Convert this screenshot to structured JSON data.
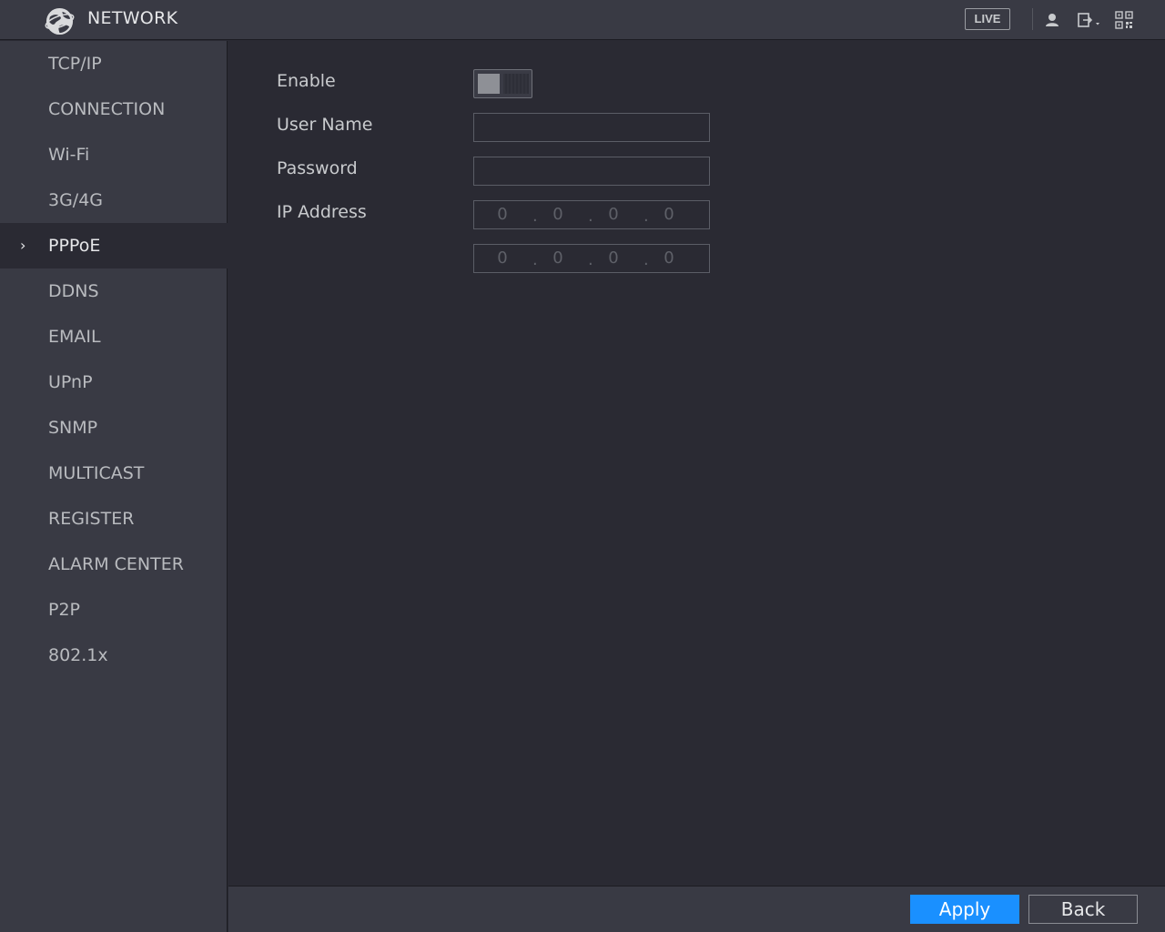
{
  "header": {
    "title": "NETWORK",
    "live_label": "LIVE",
    "icons": [
      "globe-logo-icon",
      "user-icon",
      "logout-icon",
      "qr-code-icon"
    ]
  },
  "sidebar": {
    "items": [
      {
        "label": "TCP/IP",
        "active": false
      },
      {
        "label": "CONNECTION",
        "active": false
      },
      {
        "label": "Wi-Fi",
        "active": false
      },
      {
        "label": "3G/4G",
        "active": false
      },
      {
        "label": "PPPoE",
        "active": true
      },
      {
        "label": "DDNS",
        "active": false
      },
      {
        "label": "EMAIL",
        "active": false
      },
      {
        "label": "UPnP",
        "active": false
      },
      {
        "label": "SNMP",
        "active": false
      },
      {
        "label": "MULTICAST",
        "active": false
      },
      {
        "label": "REGISTER",
        "active": false
      },
      {
        "label": "ALARM CENTER",
        "active": false
      },
      {
        "label": "P2P",
        "active": false
      },
      {
        "label": "802.1x",
        "active": false
      }
    ]
  },
  "form": {
    "enable_label": "Enable",
    "enable_value": false,
    "username_label": "User Name",
    "username_value": "",
    "password_label": "Password",
    "password_value": "",
    "ip_label": "IP Address",
    "ip_address": [
      "0",
      "0",
      "0",
      "0"
    ],
    "ip_address_2": [
      "0",
      "0",
      "0",
      "0"
    ]
  },
  "footer": {
    "apply_label": "Apply",
    "back_label": "Back"
  },
  "colors": {
    "accent": "#1a90ff",
    "background": "#2a2a33",
    "panel": "#393a44"
  }
}
